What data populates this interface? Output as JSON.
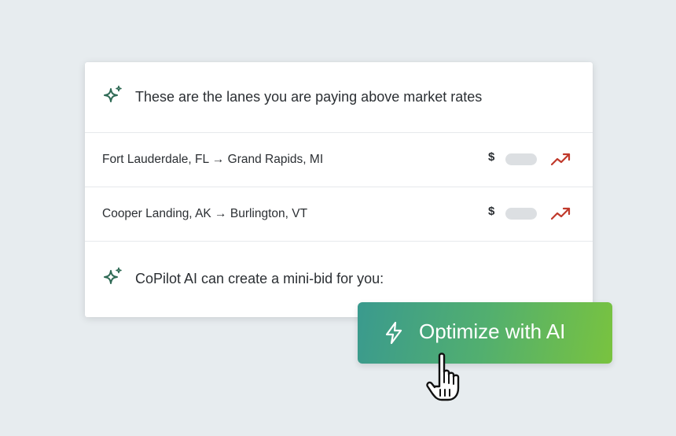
{
  "header": {
    "message": "These are the lanes you are paying above market rates",
    "icon": "sparkle-icon"
  },
  "lanes": [
    {
      "route": "Fort Lauderdale, FL → Grand Rapids, MI",
      "price_symbol": "$",
      "trend_icon": "trend-up-icon"
    },
    {
      "route": "Cooper Landing, AK → Burlington, VT",
      "price_symbol": "$",
      "trend_icon": "trend-up-icon"
    }
  ],
  "suggestion": {
    "message": "CoPilot AI can create a mini-bid for you:",
    "icon": "sparkle-icon"
  },
  "cta": {
    "label": "Optimize with AI",
    "icon": "lightning-icon"
  },
  "colors": {
    "sparkle": "#2f6a55",
    "trend_up": "#c0392b",
    "cta_gradient_start": "#3a9a8e",
    "cta_gradient_end": "#79c33f"
  }
}
